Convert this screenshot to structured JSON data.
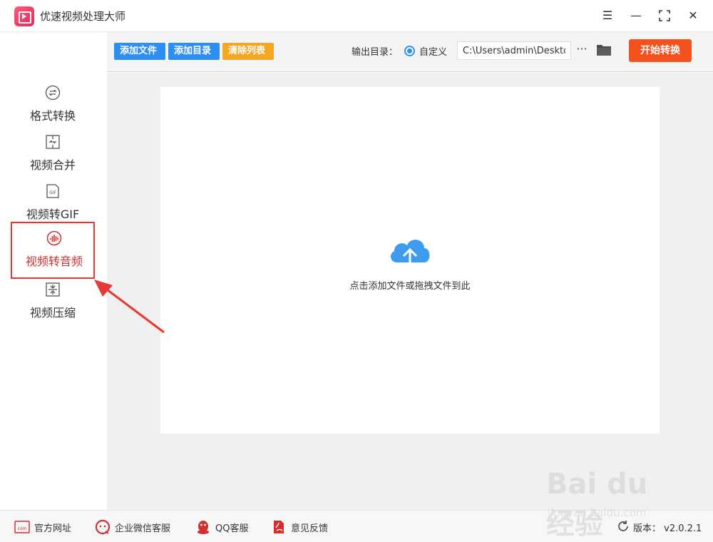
{
  "app": {
    "title": "优速视频处理大师"
  },
  "window_controls": {
    "menu": "☰",
    "minimize": "—",
    "maximize": "⛶",
    "close": "✕"
  },
  "sidebar": {
    "items": [
      {
        "label": "格式转换",
        "icon": "format-convert-icon"
      },
      {
        "label": "视频合并",
        "icon": "merge-icon"
      },
      {
        "label": "视频转GIF",
        "icon": "gif-icon"
      },
      {
        "label": "视频转音频",
        "icon": "audio-icon",
        "active": true
      },
      {
        "label": "视频压缩",
        "icon": "compress-icon"
      }
    ]
  },
  "toolbar": {
    "add_file": "添加文件",
    "add_dir": "添加目录",
    "clear_list": "清除列表",
    "output_label": "输出目录：",
    "radio_label": "自定义",
    "output_path": "C:\\Users\\admin\\Deskto",
    "more": "···",
    "start": "开始转换"
  },
  "dropzone": {
    "hint": "点击添加文件或拖拽文件到此"
  },
  "footer": {
    "site": "官方网址",
    "site_icon_text": "com",
    "wechat": "企业微信客服",
    "qq": "QQ客服",
    "feedback": "意见反馈",
    "version": "版本： v2.0.2.1"
  },
  "watermark": {
    "main": "Bai du 经验",
    "sub": "jingyan.baidu.com"
  },
  "colors": {
    "accent_blue": "#2e8ff0",
    "orange": "#f5a623",
    "start_red": "#f4511e",
    "active_red": "#d32f2f",
    "icon_red": "#d32f2f"
  }
}
